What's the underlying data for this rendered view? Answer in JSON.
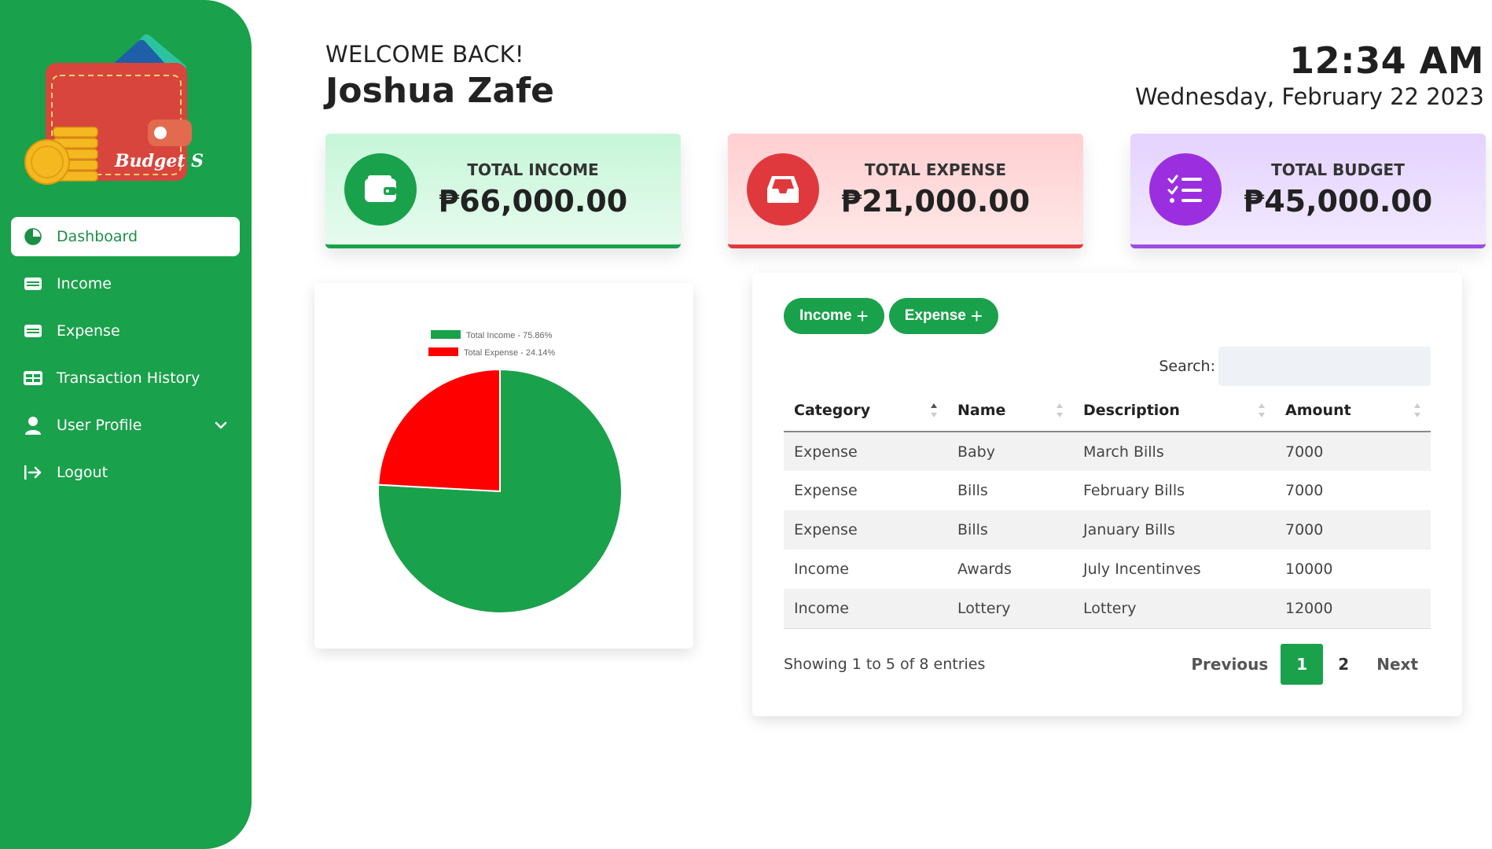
{
  "app": {
    "name": "BudgetS",
    "logo_text": "Budget S"
  },
  "sidebar": {
    "items": [
      {
        "label": "Dashboard",
        "icon": "pie-chart-icon",
        "active": true
      },
      {
        "label": "Income",
        "icon": "money-icon"
      },
      {
        "label": "Expense",
        "icon": "money-icon"
      },
      {
        "label": "Transaction History",
        "icon": "table-icon"
      },
      {
        "label": "User Profile",
        "icon": "user-icon",
        "has_submenu": true
      },
      {
        "label": "Logout",
        "icon": "logout-icon"
      }
    ]
  },
  "header": {
    "welcome": "WELCOME BACK!",
    "username": "Joshua Zafe",
    "time": "12:34 AM",
    "date": "Wednesday, February 22 2023"
  },
  "stats": {
    "income": {
      "label": "TOTAL INCOME",
      "value": "₱66,000.00",
      "color": "#1aa14b",
      "icon": "wallet-icon"
    },
    "expense": {
      "label": "TOTAL EXPENSE",
      "value": "₱21,000.00",
      "color": "#e0393d",
      "icon": "inbox-icon"
    },
    "budget": {
      "label": "TOTAL BUDGET",
      "value": "₱45,000.00",
      "color": "#9b4de2",
      "icon": "checklist-icon"
    }
  },
  "chart_data": {
    "type": "pie",
    "categories": [
      "Total Income",
      "Total Expense"
    ],
    "values": [
      75.86,
      24.14
    ],
    "legend": [
      "Total Income - 75.86%",
      "Total Expense - 24.14%"
    ],
    "colors": [
      "#1aa14b",
      "#ff0000"
    ],
    "legend_position": "top"
  },
  "transactions": {
    "add_income_label": "Income",
    "add_expense_label": "Expense",
    "search_label": "Search:",
    "search_value": "",
    "columns": [
      "Category",
      "Name",
      "Description",
      "Amount"
    ],
    "rows": [
      [
        "Expense",
        "Baby",
        "March Bills",
        "7000"
      ],
      [
        "Expense",
        "Bills",
        "February Bills",
        "7000"
      ],
      [
        "Expense",
        "Bills",
        "January Bills",
        "7000"
      ],
      [
        "Income",
        "Awards",
        "July Incentinves",
        "10000"
      ],
      [
        "Income",
        "Lottery",
        "Lottery",
        "12000"
      ]
    ],
    "info": "Showing 1 to 5 of 8 entries",
    "pagination": {
      "previous": "Previous",
      "pages": [
        "1",
        "2"
      ],
      "current": "1",
      "next": "Next"
    }
  }
}
